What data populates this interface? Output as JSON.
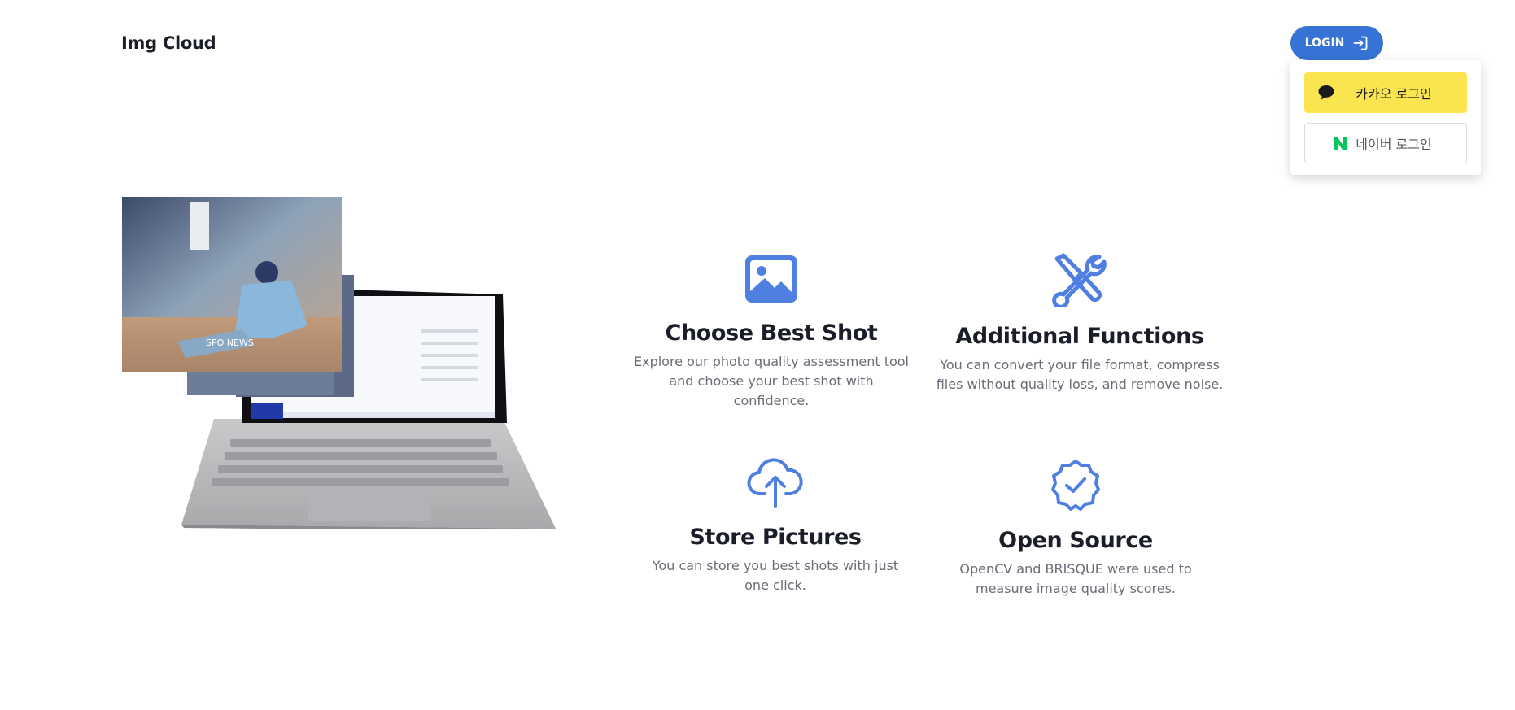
{
  "header": {
    "brand": "Img Cloud",
    "login_label": "LOGIN"
  },
  "login_menu": {
    "kakao_label": "카카오 로그인",
    "naver_label": "네이버 로그인"
  },
  "features": [
    {
      "icon": "image-icon",
      "title": "Choose Best Shot",
      "description": "Explore our photo quality assessment tool and choose your best shot with confidence."
    },
    {
      "icon": "tools-icon",
      "title": "Additional Functions",
      "description": "You can convert your file format, compress files without quality loss, and remove noise."
    },
    {
      "icon": "cloud-upload-icon",
      "title": "Store Pictures",
      "description": "You can store you best shots with just one click."
    },
    {
      "icon": "verified-badge-icon",
      "title": "Open Source",
      "description": "OpenCV and BRISQUE were used to measure image quality scores."
    }
  ],
  "hero_overlay_text": "SPO NEWS",
  "colors": {
    "accent": "#3673d4",
    "kakao": "#fae550",
    "naver": "#03c75a",
    "icon_blue": "#4f7fe0"
  }
}
